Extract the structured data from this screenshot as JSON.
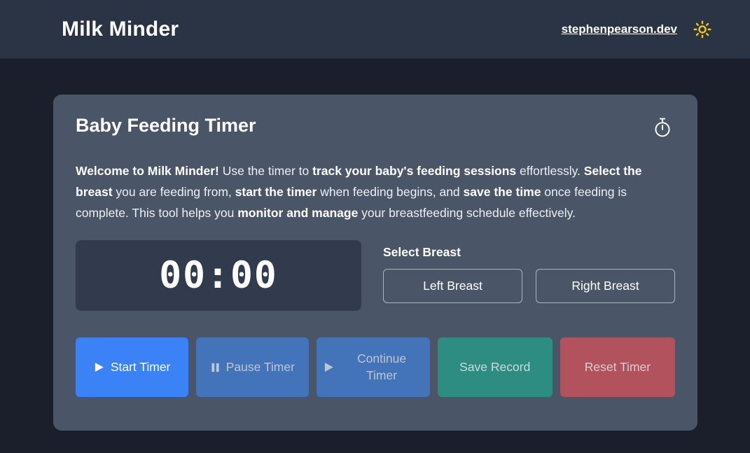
{
  "header": {
    "brand": "Milk Minder",
    "site_link": "stephenpearson.dev",
    "theme_icon": "sun-icon",
    "theme_icon_color": "#f5c518",
    "background": "#2b3445"
  },
  "card": {
    "title": "Baby Feeding Timer",
    "title_icon": "stopwatch-icon",
    "background": "#4a5568",
    "intro": {
      "segments": [
        {
          "text": "Welcome to Milk Minder!",
          "bold": true
        },
        {
          "text": " Use the timer to ",
          "bold": false
        },
        {
          "text": "track your baby's feeding sessions",
          "bold": true
        },
        {
          "text": " effortlessly. ",
          "bold": false
        },
        {
          "text": "Select the breast",
          "bold": true
        },
        {
          "text": " you are feeding from, ",
          "bold": false
        },
        {
          "text": "start the timer",
          "bold": true
        },
        {
          "text": " when feeding begins, and ",
          "bold": false
        },
        {
          "text": "save the time",
          "bold": true
        },
        {
          "text": " once feeding is complete. This tool helps you ",
          "bold": false
        },
        {
          "text": "monitor and manage",
          "bold": true
        },
        {
          "text": " your breastfeeding schedule effectively.",
          "bold": false
        }
      ]
    },
    "timer": {
      "value": "00:00",
      "background": "#323b4d"
    },
    "breast_select": {
      "label": "Select Breast",
      "options": [
        {
          "label": "Left Breast"
        },
        {
          "label": "Right Breast"
        }
      ]
    },
    "actions": [
      {
        "label": "Start Timer",
        "icon": "play-icon",
        "color": "#3b82f6",
        "state": "enabled"
      },
      {
        "label": "Pause Timer",
        "icon": "pause-icon",
        "color": "#4373b8",
        "state": "disabled"
      },
      {
        "label": "Continue Timer",
        "icon": "play-icon",
        "color": "#4373b8",
        "state": "disabled"
      },
      {
        "label": "Save Record",
        "icon": "none",
        "color": "#2d8d82",
        "state": "disabled"
      },
      {
        "label": "Reset Timer",
        "icon": "none",
        "color": "#b2525c",
        "state": "disabled"
      }
    ]
  },
  "page": {
    "background": "#1a1f2b"
  }
}
